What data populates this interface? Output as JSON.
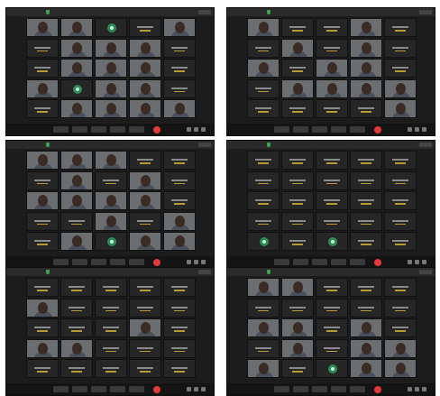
{
  "panels": [
    {
      "id": "top-left",
      "title": "",
      "toolbar": {
        "mic": "Mute",
        "video": "Stop Video",
        "share": "Share",
        "chat": "Chat",
        "record": "Record"
      },
      "tiles": [
        [
          "video",
          "v",
          "avatar",
          "name",
          "video"
        ],
        [
          "name",
          "video",
          "video",
          "video",
          "name"
        ],
        [
          "name",
          "video",
          "video",
          "video",
          "name"
        ],
        [
          "video",
          "avatar",
          "video",
          "video",
          "name"
        ],
        [
          "name",
          "video",
          "video",
          "video",
          "video"
        ]
      ]
    },
    {
      "id": "top-right",
      "title": "",
      "toolbar": {
        "mic": "Mute",
        "video": "Stop Video",
        "share": "Share",
        "chat": "Chat",
        "record": "Record"
      },
      "tiles": [
        [
          "video",
          "name",
          "name",
          "video",
          "name"
        ],
        [
          "name",
          "video",
          "name",
          "video",
          "name"
        ],
        [
          "video",
          "name",
          "video",
          "video",
          "name"
        ],
        [
          "name",
          "video",
          "video",
          "video",
          "video"
        ],
        [
          "name",
          "name",
          "name",
          "name",
          "video"
        ]
      ]
    },
    {
      "id": "middle-left",
      "title": "",
      "toolbar": {
        "mic": "Mute",
        "video": "Stop Video",
        "share": "Share",
        "chat": "Chat",
        "record": "Record"
      },
      "tiles": [
        [
          "video",
          "video",
          "video",
          "name",
          "name"
        ],
        [
          "name",
          "video",
          "name",
          "video",
          "name"
        ],
        [
          "video",
          "video",
          "video",
          "video",
          "name"
        ],
        [
          "name",
          "name",
          "video",
          "name",
          "video"
        ],
        [
          "name",
          "video",
          "avatar",
          "video",
          "video"
        ]
      ]
    },
    {
      "id": "middle-right",
      "title": "",
      "toolbar": {
        "mic": "Mute",
        "video": "Stop Video",
        "share": "Share",
        "chat": "Chat",
        "record": "Record"
      },
      "tiles": [
        [
          "name",
          "name",
          "name",
          "name",
          "name"
        ],
        [
          "name",
          "name",
          "name",
          "name",
          "name"
        ],
        [
          "name",
          "name",
          "name",
          "name",
          "name"
        ],
        [
          "name",
          "name",
          "name",
          "name",
          "name"
        ],
        [
          "avatar",
          "name",
          "avatar",
          "name",
          "name"
        ]
      ]
    },
    {
      "id": "bottom-left",
      "title": "",
      "toolbar": {
        "mic": "Mute",
        "video": "Stop Video",
        "share": "Share",
        "chat": "Chat",
        "record": "Record"
      },
      "tiles": [
        [
          "name",
          "name",
          "name",
          "name",
          "name"
        ],
        [
          "video",
          "name",
          "name",
          "name",
          "name"
        ],
        [
          "name",
          "name",
          "name",
          "video",
          "name"
        ],
        [
          "video",
          "video",
          "name",
          "name",
          "name"
        ],
        [
          "name",
          "name",
          "name",
          "name",
          "name"
        ]
      ]
    },
    {
      "id": "bottom-right",
      "title": "",
      "toolbar": {
        "mic": "Mute",
        "video": "Stop Video",
        "share": "Share",
        "chat": "Chat",
        "record": "Record"
      },
      "tiles": [
        [
          "video",
          "video",
          "name",
          "name",
          "name"
        ],
        [
          "name",
          "name",
          "name",
          "name",
          "name"
        ],
        [
          "video",
          "video",
          "name",
          "video",
          "name"
        ],
        [
          "name",
          "video",
          "name",
          "video",
          "video"
        ],
        [
          "video",
          "name",
          "avatar",
          "video",
          "video"
        ]
      ]
    }
  ]
}
